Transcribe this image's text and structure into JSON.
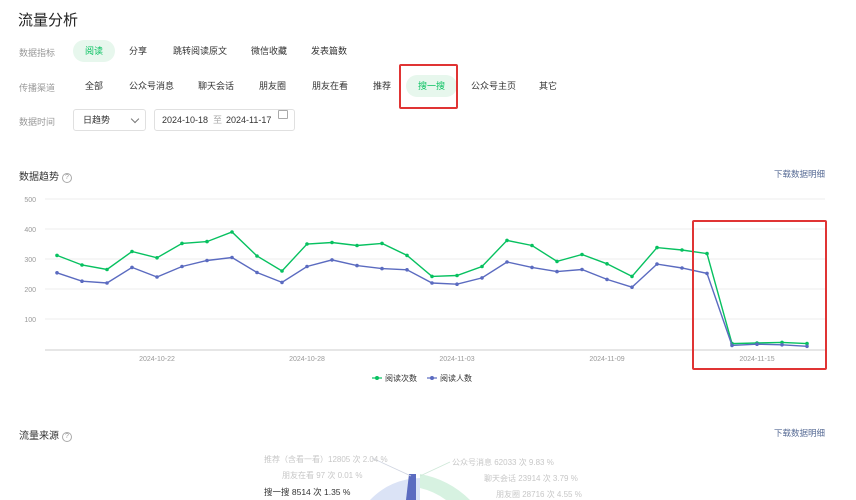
{
  "page_title": "流量分析",
  "metric_row": {
    "label": "数据指标",
    "items": [
      "阅读",
      "分享",
      "跳转阅读原文",
      "微信收藏",
      "发表篇数"
    ],
    "active_index": 0
  },
  "channel_row": {
    "label": "传播渠道",
    "items": [
      "全部",
      "公众号消息",
      "聊天会话",
      "朋友圈",
      "朋友在看",
      "推荐",
      "搜一搜",
      "公众号主页",
      "其它"
    ],
    "active_index": 6
  },
  "time_row": {
    "label": "数据时间",
    "granularity": "日趋势",
    "start_date": "2024-10-18",
    "separator": "至",
    "end_date": "2024-11-17"
  },
  "trend_section": {
    "title": "数据趋势",
    "help_icon": "?",
    "download_label": "下载数据明细"
  },
  "source_section": {
    "title": "流量来源",
    "help_icon": "?",
    "download_label": "下载数据明细",
    "labels": [
      "推荐（含看一看）12805 次 2.04 %",
      "朋友在看 97 次 0.01 %",
      "搜一搜 8514 次 1.35 %",
      "公众号消息 62033 次 9.83 %",
      "聊天会话 23914 次 3.79 %",
      "朋友圈 28716 次 4.55 %"
    ]
  },
  "colors": {
    "accent": "#07c160",
    "series_blue": "#5b6bc0",
    "highlight_red": "#e03434",
    "link": "#576b95"
  },
  "chart_data": {
    "type": "line",
    "x": [
      "2024-10-18",
      "2024-10-19",
      "2024-10-20",
      "2024-10-21",
      "2024-10-22",
      "2024-10-23",
      "2024-10-24",
      "2024-10-25",
      "2024-10-26",
      "2024-10-27",
      "2024-10-28",
      "2024-10-29",
      "2024-10-30",
      "2024-10-31",
      "2024-11-01",
      "2024-11-02",
      "2024-11-03",
      "2024-11-04",
      "2024-11-05",
      "2024-11-06",
      "2024-11-07",
      "2024-11-08",
      "2024-11-09",
      "2024-11-10",
      "2024-11-11",
      "2024-11-12",
      "2024-11-13",
      "2024-11-14",
      "2024-11-15",
      "2024-11-16",
      "2024-11-17"
    ],
    "x_tick_labels": [
      "2024-10-22",
      "2024-10-28",
      "2024-11-03",
      "2024-11-09",
      "2024-11-15"
    ],
    "y_ticks": [
      100,
      200,
      300,
      400,
      500
    ],
    "ylim": [
      0,
      500
    ],
    "series": [
      {
        "name": "阅读次数",
        "color": "#07c160",
        "values": [
          312,
          280,
          265,
          325,
          304,
          352,
          358,
          390,
          310,
          260,
          350,
          355,
          345,
          352,
          312,
          242,
          245,
          275,
          362,
          345,
          292,
          315,
          284,
          242,
          338,
          330,
          318,
          18,
          20,
          22,
          18
        ]
      },
      {
        "name": "阅读人数",
        "color": "#5b6bc0",
        "values": [
          254,
          226,
          220,
          272,
          240,
          275,
          295,
          305,
          255,
          222,
          275,
          297,
          278,
          268,
          264,
          220,
          216,
          237,
          290,
          272,
          258,
          265,
          232,
          206,
          283,
          270,
          252,
          12,
          16,
          14,
          9
        ]
      }
    ],
    "legend_position": "bottom-center",
    "grid": true
  }
}
